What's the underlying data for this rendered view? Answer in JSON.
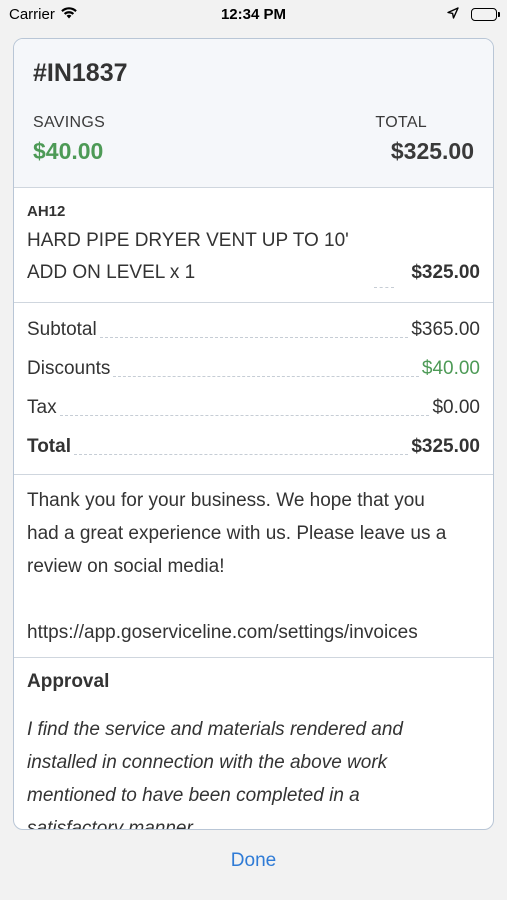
{
  "status_bar": {
    "carrier": "Carrier",
    "time": "12:34 PM",
    "icons": [
      "wifi-icon",
      "location-arrow-icon",
      "battery-icon"
    ]
  },
  "invoice": {
    "number": "#IN1837",
    "savings_label": "SAVINGS",
    "savings_value": "$40.00",
    "total_label": "TOTAL",
    "total_value": "$325.00"
  },
  "line_item": {
    "code": "AH12",
    "description": "HARD PIPE DRYER VENT UP TO 10'",
    "quantity_text": "ADD ON LEVEL x 1",
    "amount": "$325.00"
  },
  "summary": {
    "subtotal_label": "Subtotal",
    "subtotal_value": "$365.00",
    "discounts_label": "Discounts",
    "discounts_value": "$40.00",
    "tax_label": "Tax",
    "tax_value": "$0.00",
    "total_label": "Total",
    "total_value": "$325.00"
  },
  "message": {
    "lines": [
      "Thank you for your business. We hope that you",
      "had a great experience with us. Please leave us a",
      "review on social media!"
    ],
    "url": "https://app.goserviceline.com/settings/invoices"
  },
  "approval": {
    "title": "Approval",
    "lines": [
      "I find the service and materials rendered and",
      "installed in connection with the above work",
      "mentioned to have been completed in a",
      "satisfactory manner"
    ]
  },
  "done_label": "Done",
  "colors": {
    "accent": "#2f7bd6",
    "savings_green": "#4d9a56",
    "card_border": "#b9c6d6"
  }
}
